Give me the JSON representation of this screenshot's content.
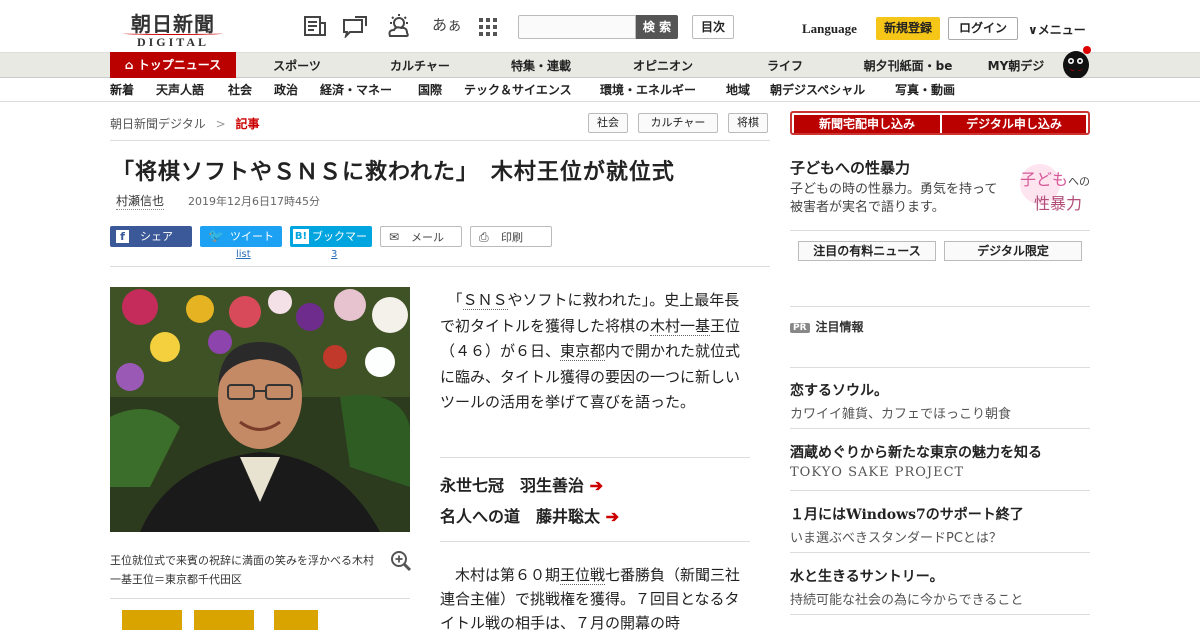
{
  "header": {
    "logo_jp": "朝日新聞",
    "logo_en": "DIGITAL",
    "search_button": "検 索",
    "index_button": "目次",
    "language": "Language",
    "register": "新規登録",
    "login": "ログイン",
    "menu": "∨メニュー",
    "font_toggle": "あぁ"
  },
  "nav_primary": [
    "トップニュース",
    "スポーツ",
    "カルチャー",
    "特集・連載",
    "オピニオン",
    "ライフ",
    "朝夕刊紙面・be",
    "MY朝デジ"
  ],
  "nav_secondary": [
    "新着",
    "天声人語",
    "社会",
    "政治",
    "経済・マネー",
    "国際",
    "テック＆サイエンス",
    "環境・エネルギー",
    "地域",
    "朝デジスペシャル",
    "写真・動画"
  ],
  "breadcrumb": {
    "home": "朝日新聞デジタル",
    "sep": ">",
    "current": "記事"
  },
  "tags": [
    "社会",
    "カルチャー",
    "将棋"
  ],
  "article": {
    "title": "「将棋ソフトやＳＮＳに救われた」　木村王位が就位式",
    "author": "村瀬信也",
    "date": "2019年12月6日17時45分",
    "share": {
      "facebook": "シェア",
      "twitter": "ツイート",
      "hatena": "ブックマーク",
      "hatena_badge": "B!",
      "mail": "メール",
      "print": "印刷",
      "twitter_count": "list",
      "hatena_count": "3"
    },
    "caption": "王位就位式で来賓の祝辞に満面の笑みを浮かべる木村一基王位＝東京都千代田区",
    "lead_parts": [
      "　「",
      "ＳＮＳ",
      "やソフトに救われた」。史上最年長で初タイトルを獲得した将棋の",
      "木村一基",
      "王位（４６）が６日、",
      "東京都",
      "内で開かれた就位式に臨み、タイトル獲得の要因の一つに新しいツールの活用を挙げて喜びを語った。"
    ],
    "related": [
      {
        "label": "永世七冠　羽生善治",
        "arrow": "➔"
      },
      {
        "label": "名人への道　藤井聡太",
        "arrow": "➔"
      }
    ],
    "body2_parts": [
      "　木村は第６０期",
      "王位戦",
      "七番勝負（新聞三社連合主催）で挑戦権を獲得。７回目となるタイトル戦の相手は、７月の開幕の時"
    ]
  },
  "sidebar": {
    "subscribe": [
      "新聞宅配申し込み",
      "デジタル申し込み"
    ],
    "feature_title": "子どもへの性暴力",
    "feature_desc": "子どもの時の性暴力。勇気を持って被害者が実名で語ります。",
    "feature_img_text": [
      "子ども",
      "への",
      "性暴力"
    ],
    "tabs": [
      "注目の有料ニュース",
      "デジタル限定"
    ],
    "pr_badge": "PR",
    "pr_label": "注目情報",
    "ads": [
      {
        "title": "恋するソウル。",
        "desc": "カワイイ雑貨、カフェでほっこり朝食"
      },
      {
        "title": "酒蔵めぐりから新たな東京の魅力を知る",
        "desc": "TOKYO SAKE PROJECT"
      },
      {
        "title": "１月にはWindows7のサポート終了",
        "desc": "いま選ぶべきスタンダードPCとは？"
      },
      {
        "title": "水と生きるサントリー。",
        "desc": "持続可能な社会の為に今からできること"
      }
    ]
  },
  "colors": {
    "brand_red": "#bb0000",
    "facebook": "#3b5998",
    "twitter": "#1da1f2",
    "hatena": "#00a4de",
    "register_yellow": "#f5c518"
  }
}
